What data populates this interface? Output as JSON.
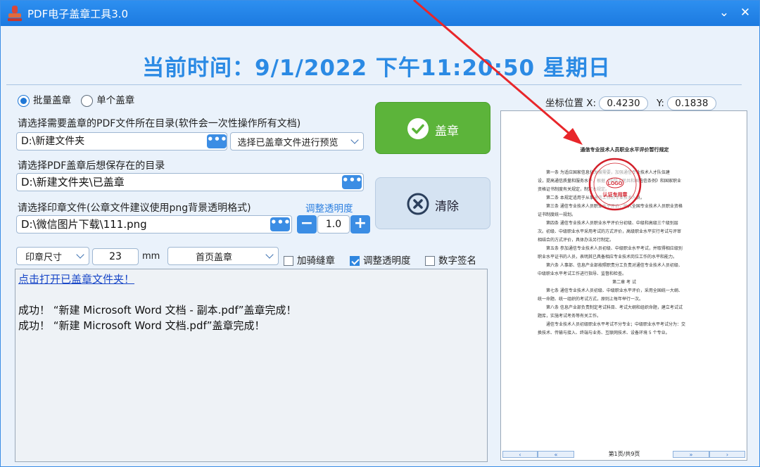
{
  "window": {
    "title": "PDF电子盖章工具3.0",
    "minimize": "⌄",
    "close": "✕"
  },
  "clock": "当前时间：9/1/2022 下午11:20:50 星期日",
  "mode": {
    "batch_label": "批量盖章",
    "single_label": "单个盖章",
    "selected": "批量盖章"
  },
  "pdf_dir": {
    "label": "请选择需要盖章的PDF文件所在目录(软件会一次性操作所有文档)",
    "value": "D:\\新建文件夹",
    "browse": "•••",
    "preview_select": "选择已盖章文件进行预览"
  },
  "save_dir": {
    "label": "请选择PDF盖章后想保存在的目录",
    "value": "D:\\新建文件夹\\已盖章",
    "browse": "•••"
  },
  "stamp_file": {
    "label": "请选择印章文件(公章文件建议使用png背景透明格式)",
    "value": "D:\\微信图片下载\\111.png",
    "browse": "•••"
  },
  "opacity": {
    "label": "调整透明度",
    "value": "1.0",
    "minus": "−",
    "plus": "+"
  },
  "stamp_size": {
    "select": "印章尺寸",
    "value": "23",
    "unit": "mm"
  },
  "page_select": "首页盖章",
  "options": {
    "seam": {
      "label": "加骑缝章",
      "checked": false
    },
    "opacity": {
      "label": "调整透明度",
      "checked": true
    },
    "signature": {
      "label": "数字签名",
      "checked": false
    }
  },
  "buttons": {
    "stamp": "盖章",
    "clear": "清除"
  },
  "log": {
    "link": "点击打开已盖章文件夹！",
    "lines": [
      "成功！ “新建 Microsoft  Word 文档 - 副本.pdf”盖章完成！",
      "成功！ “新建 Microsoft  Word 文档.pdf”盖章完成！"
    ]
  },
  "coords": {
    "label": "坐标位置",
    "x_label": "X:",
    "x": "0.4230",
    "y_label": "Y:",
    "y": "0.1838"
  },
  "preview": {
    "doc_title": "通信专业技术人员职业水平评价暂行规定",
    "seal_text": "LOGO",
    "seal_bottom": "认证专用章",
    "paragraphs": [
      "第一条 为适应国家信息化发展需要，加强通信专业技术人才队伍建",
      "设，提高通信质量和服务水平，根据《中华人民共和国电信条例》和国家职业",
      "资格证书制度有关规定，制定本规定。",
      "第二条 本规定适用于从事通信工作的专业技术人员。",
      "第三条 通信专业技术人员职业水平评价，纳入全国专业技术人员职业资格",
      "证书制度统一规划。",
      "第四条 通信专业技术人员职业水平评价分初级、中级和高级三个级别层",
      "次。初级、中级职业水平采用考试的方式评价，高级职业水平实行考试与评审",
      "相结合的方式评价，具体办法另行制定。",
      "第五条 参加通信专业技术人员初级、中级职业水平考试，并取得相应级别",
      "职业水平证书的人员，表明其已具备相应专业技术岗位工作的水平和能力。",
      "第六条 人事部、信息产业部按照职责分工负责对通信专业技术人员初级、",
      "中级职业水平考试工作进行指导、监督和检查。",
      "第二章 考 试",
      "第七条 通信专业技术人员初级、中级职业水平评价，采用全国统一大纲、",
      "统一命题、统一组织的考试方式，原则上每年举行一次。",
      "第八条 信息产业部负责制定考试科目、考试大纲和组织命题，建立考试试",
      "题库，实施考试考务等有关工作。",
      "通信专业技术人员初级职业水平考试不分专业；中级职业水平考试分为：交",
      "换技术、传输与接入、终端与业务、互联网技术、设备环境 5 个专业。"
    ],
    "page_info": "第1页/共9页",
    "nav": [
      "‹",
      "«",
      "»",
      "›"
    ]
  }
}
